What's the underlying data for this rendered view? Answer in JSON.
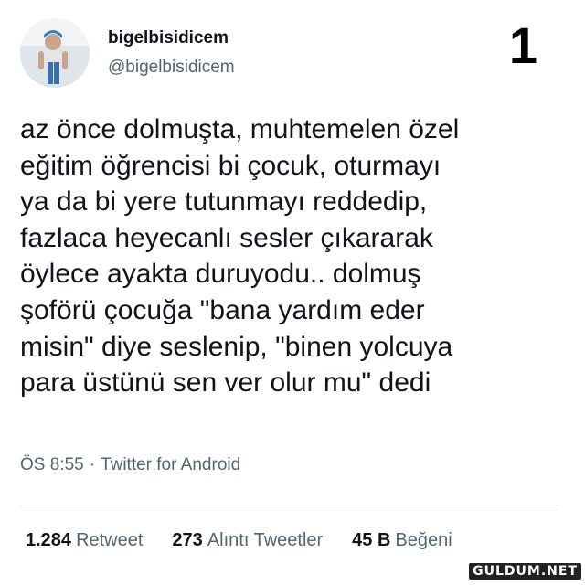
{
  "user": {
    "display_name": "bigelbisidicem",
    "handle": "@bigelbisidicem",
    "avatar_icon": "profile-photo-icon"
  },
  "tweet_number": "1",
  "tweet": {
    "text": "az önce dolmuşta, muhtemelen özel\neğitim öğrencisi bi çocuk, oturmayı\nya da bi yere tutunmayı reddedip,\nfazlaca heyecanlı sesler çıkararak\nöylece ayakta duruyodu.. dolmuş\nşoförü çocuğa \"bana yardım eder\nmisin\" diye seslenip, \"binen yolcuya\npara üstünü sen ver olur mu\" dedi",
    "time": "ÖS 8:55",
    "separator": "·",
    "source": "Twitter for Android"
  },
  "stats": {
    "retweets_count": "1.284",
    "retweets_label": "Retweet",
    "quotes_count": "273",
    "quotes_label": "Alıntı Tweetler",
    "likes_count": "45 B",
    "likes_label": "Beğeni"
  },
  "watermark": "GULDUM.NET",
  "colors": {
    "text_primary": "#0f1419",
    "text_secondary": "#536471",
    "divider": "#e6ecf0"
  }
}
